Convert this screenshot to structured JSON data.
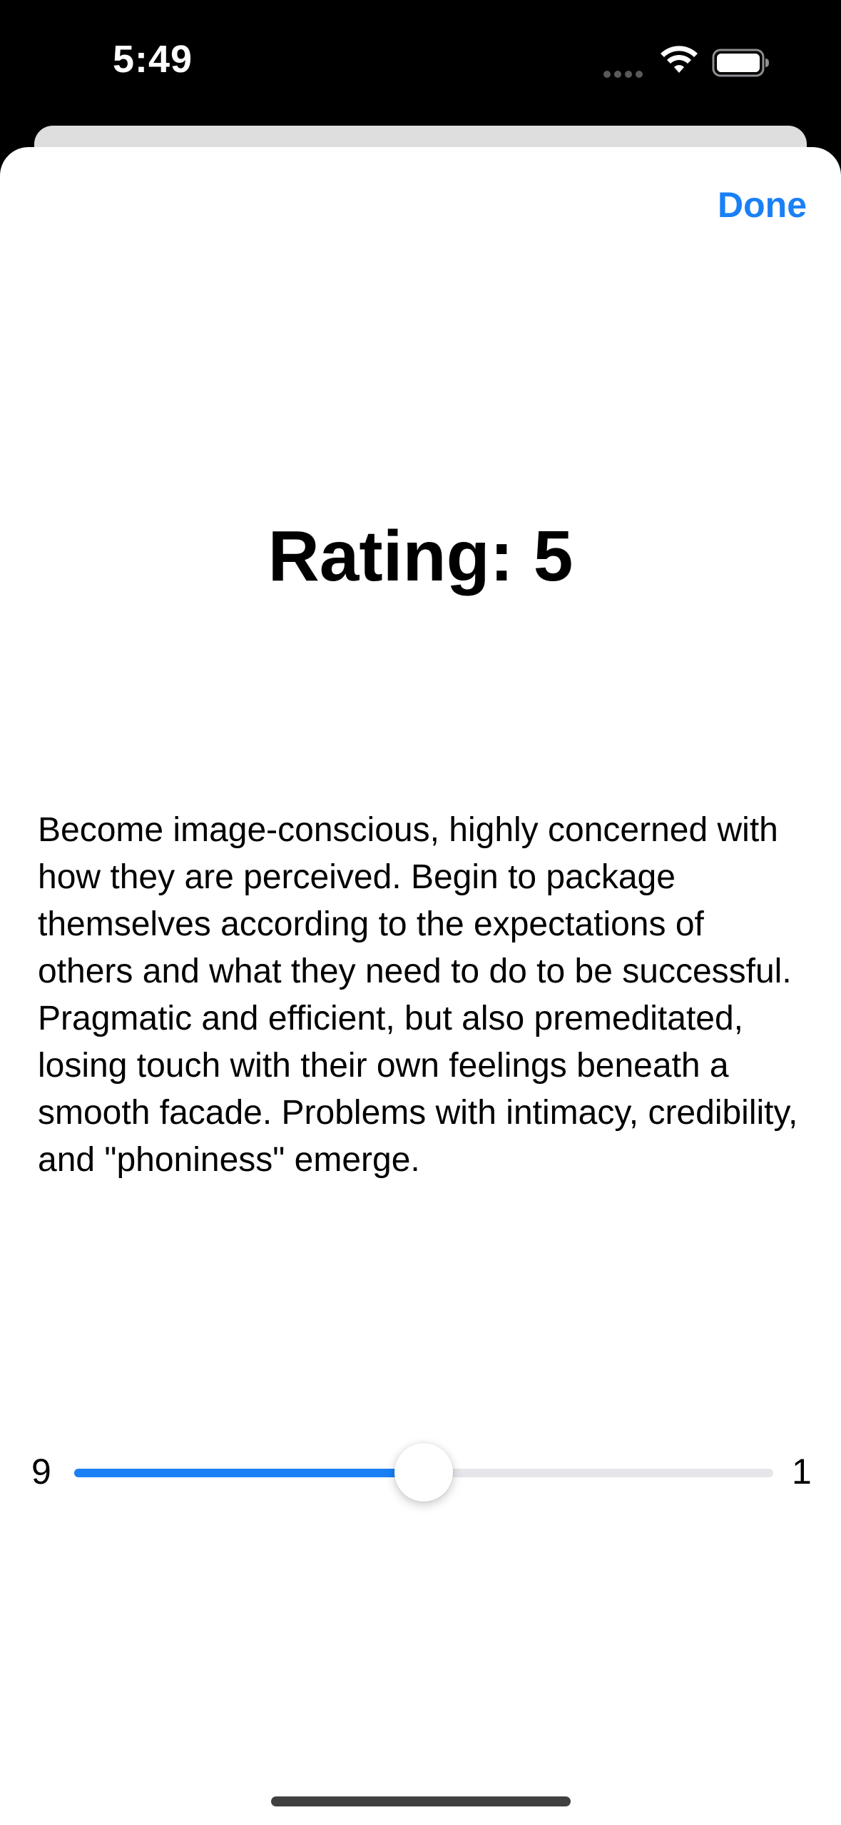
{
  "status_bar": {
    "time": "5:49",
    "icons": [
      "signal-dots-icon",
      "wifi-icon",
      "battery-icon"
    ]
  },
  "header": {
    "done_label": "Done"
  },
  "rating": {
    "title": "Rating: 5",
    "description": "Become image-conscious, highly concerned with how they are perceived. Begin to package themselves according to the expectations of others and what they need to do to be successful. Pragmatic and efficient, but also premeditated, losing touch with their own feelings beneath a smooth facade. Problems with intimacy, credibility, and \"phoniness\" emerge."
  },
  "slider": {
    "min_label": "9",
    "max_label": "1",
    "fraction": 0.5
  },
  "colors": {
    "accent": "#1a80f5",
    "sheet_background": "#ffffff",
    "status_background": "#000000"
  }
}
